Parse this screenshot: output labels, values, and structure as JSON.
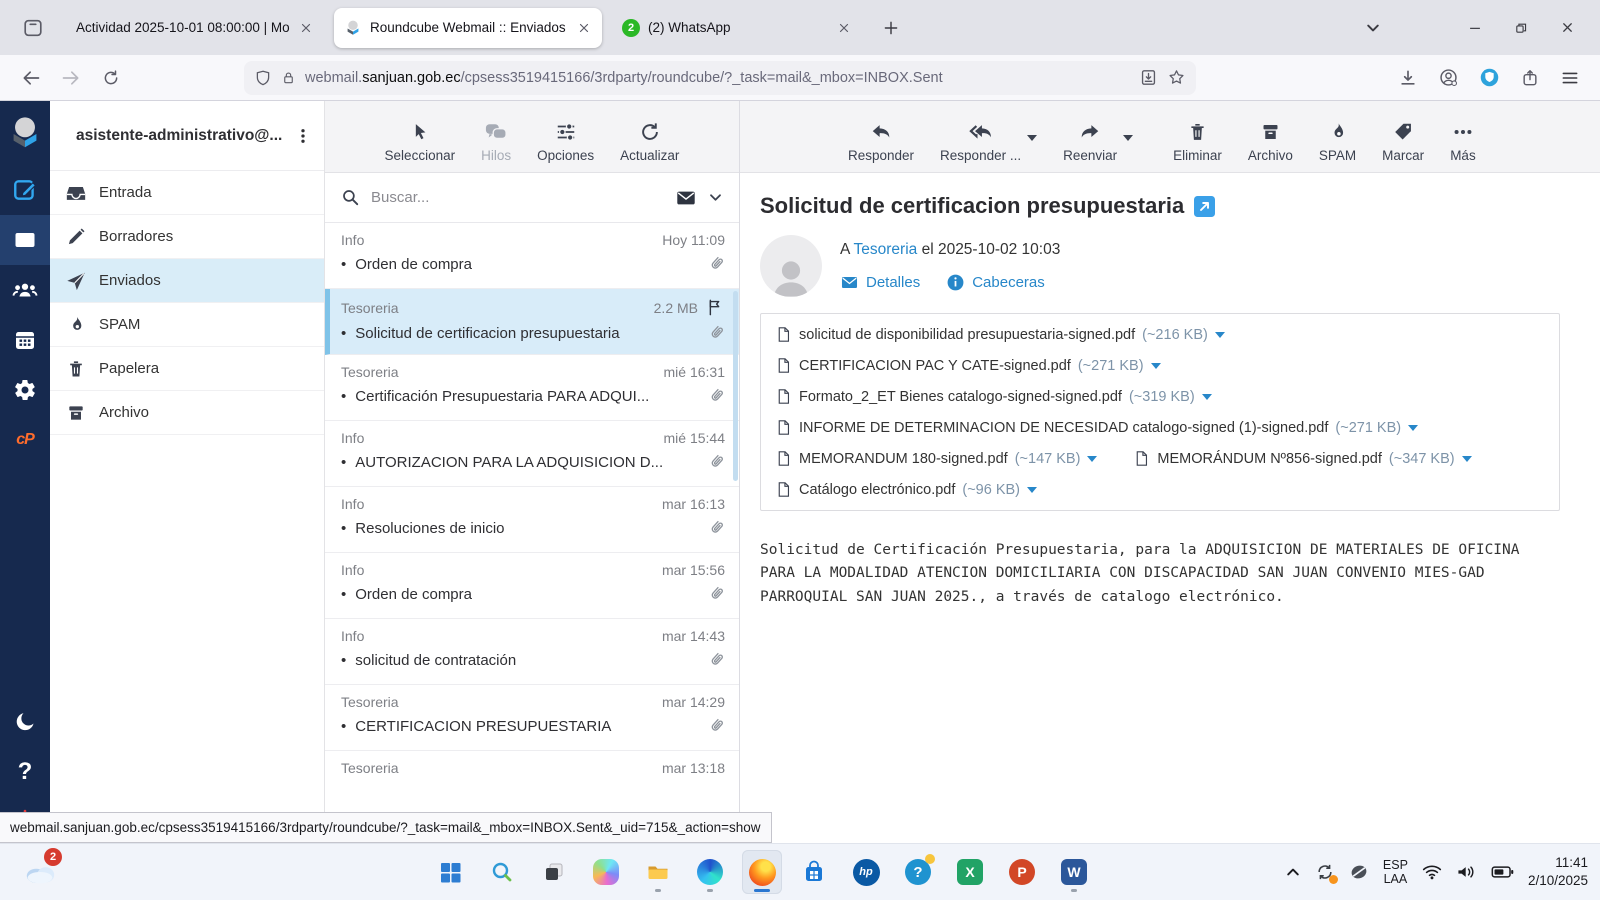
{
  "browser": {
    "tabs": [
      {
        "title": "Actividad 2025-10-01 08:00:00 | Mo"
      },
      {
        "title": "Roundcube Webmail :: Enviados"
      },
      {
        "title": "(2) WhatsApp",
        "favicon_badge": "2"
      }
    ],
    "url": {
      "prefix": "webmail.",
      "domain": "sanjuan.gob.ec",
      "path": "/cpsess3519415166/3rdparty/roundcube/?_task=mail&_mbox=INBOX.Sent"
    }
  },
  "webmail": {
    "account": "asistente-administrativo@...",
    "folders": [
      {
        "label": "Entrada"
      },
      {
        "label": "Borradores"
      },
      {
        "label": "Enviados"
      },
      {
        "label": "SPAM"
      },
      {
        "label": "Papelera"
      },
      {
        "label": "Archivo"
      }
    ],
    "list_toolbar": {
      "select": "Seleccionar",
      "threads": "Hilos",
      "options": "Opciones",
      "refresh": "Actualizar"
    },
    "search_placeholder": "Buscar...",
    "messages": [
      {
        "sender": "Info",
        "meta": "Hoy 11:09",
        "subject": "Orden de compra"
      },
      {
        "sender": "Tesoreria",
        "meta": "2.2 MB",
        "subject": "Solicitud de certificacion presupuestaria"
      },
      {
        "sender": "Tesoreria",
        "meta": "mié 16:31",
        "subject": "Certificación Presupuestaria PARA ADQUI..."
      },
      {
        "sender": "Info",
        "meta": "mié 15:44",
        "subject": "AUTORIZACION PARA LA ADQUISICION D..."
      },
      {
        "sender": "Info",
        "meta": "mar 16:13",
        "subject": "Resoluciones de inicio"
      },
      {
        "sender": "Info",
        "meta": "mar 15:56",
        "subject": "Orden de compra"
      },
      {
        "sender": "Info",
        "meta": "mar 14:43",
        "subject": "solicitud de contratación"
      },
      {
        "sender": "Tesoreria",
        "meta": "mar 14:29",
        "subject": "CERTIFICACION PRESUPUESTARIA"
      },
      {
        "sender": "Tesoreria",
        "meta": "mar 13:18"
      }
    ],
    "reader_toolbar": {
      "reply": "Responder",
      "reply_all": "Responder ...",
      "forward": "Reenviar",
      "delete": "Eliminar",
      "archive": "Archivo",
      "spam": "SPAM",
      "mark": "Marcar",
      "more": "Más"
    },
    "message": {
      "subject": "Solicitud de certificacion presupuestaria",
      "to_prefix": "A",
      "to": "Tesoreria",
      "date_text": "el 2025-10-02 10:03",
      "details_label": "Detalles",
      "headers_label": "Cabeceras",
      "attachments": [
        {
          "name": "solicitud de disponibilidad presupuestaria-signed.pdf",
          "size": "(~216 KB)"
        },
        {
          "name": "CERTIFICACION PAC Y CATE-signed.pdf",
          "size": "(~271 KB)"
        },
        {
          "name": "Formato_2_ET Bienes catalogo-signed-signed.pdf",
          "size": "(~319 KB)"
        },
        {
          "name": "INFORME DE DETERMINACION DE NECESIDAD catalogo-signed (1)-signed.pdf",
          "size": "(~271 KB)"
        },
        {
          "name": "MEMORANDUM 180-signed.pdf",
          "size": "(~147 KB)"
        },
        {
          "name": "MEMORÁNDUM Nº856-signed.pdf",
          "size": "(~347 KB)"
        },
        {
          "name": "Catálogo electrónico.pdf",
          "size": "(~96 KB)"
        }
      ],
      "body": "Solicitud de Certificación Presupuestaria, para la ADQUISICION DE MATERIALES DE OFICINA PARA LA MODALIDAD ATENCION DOMICILIARIA CON DISCAPACIDAD SAN JUAN CONVENIO MIES-GAD PARROQUIAL SAN JUAN 2025., a través de catalogo electrónico."
    }
  },
  "status_url": "webmail.sanjuan.gob.ec/cpsess3519415166/3rdparty/roundcube/?_task=mail&_mbox=INBOX.Sent&_uid=715&_action=show",
  "rail": {
    "help_glyph": "?",
    "cpanel_glyph": "cP"
  },
  "taskbar": {
    "weather_badge": "2",
    "hp_glyph": "hp",
    "help_glyph": "?",
    "excel_glyph": "X",
    "powerpoint_glyph": "P",
    "word_glyph": "W",
    "language_line1": "ESP",
    "language_line2": "LAA",
    "time": "11:41",
    "date": "2/10/2025"
  },
  "colors": {
    "accent_blue": "#2787c9",
    "rail_navy": "#16294e",
    "selected_row": "#d8ecf9",
    "cpanel_orange": "#ff6c2c"
  }
}
